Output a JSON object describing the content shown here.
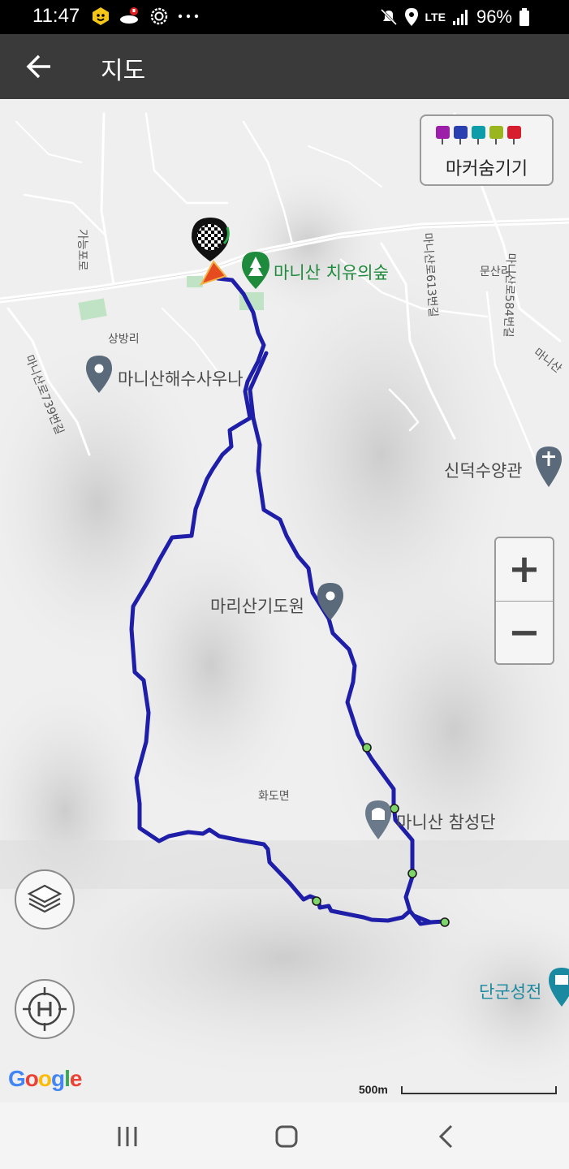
{
  "status_bar": {
    "time": "11:47",
    "network": "LTE",
    "battery": "96%",
    "icons": [
      "notification-app-icon",
      "notification-app-icon-2",
      "settings-ring-icon",
      "more-dots-icon",
      "mute-icon",
      "location-icon",
      "signal-icon",
      "battery-icon"
    ]
  },
  "app_bar": {
    "title": "지도",
    "back_icon": "arrow-left-icon"
  },
  "map": {
    "marker_toggle_label": "마커숨기기",
    "marker_pin_icons": [
      "camera-icon",
      "video-icon",
      "mic-icon",
      "note-icon",
      "flag-icon"
    ],
    "marker_pin_colors": [
      "#9b1fa8",
      "#2a3fb0",
      "#0d9da8",
      "#9ab61e",
      "#d61e2e"
    ],
    "track_color": "#1e1ea8",
    "waypoint_color": "#7ed56a",
    "pois": [
      {
        "name": "마니산 치유의숲",
        "icon": "park-pin-icon",
        "color": "#1e8a3c"
      },
      {
        "name": "마니산해수사우나",
        "icon": "place-pin-icon",
        "color": "#5a6a7a"
      },
      {
        "name": "신덕수양관",
        "icon": "church-pin-icon",
        "color": "#5a6a7a"
      },
      {
        "name": "마리산기도원",
        "icon": "place-pin-icon",
        "color": "#5a6a7a"
      },
      {
        "name": "마니산 참성단",
        "icon": "monument-pin-icon",
        "color": "#5a6a7a"
      },
      {
        "name": "단군성전",
        "icon": "museum-pin-icon",
        "color": "#1b8aa0"
      }
    ],
    "road_labels": [
      "가능포로",
      "상방리",
      "마니산로739번길",
      "마니산로613번길",
      "마니산로584번길",
      "문산리",
      "마니산",
      "화도면"
    ],
    "scale_label": "500m",
    "google_logo": "Google",
    "zoom_in_label": "+",
    "zoom_out_label": "−"
  },
  "nav_bar": {
    "icons": [
      "recent-apps-icon",
      "home-icon",
      "back-icon"
    ]
  }
}
